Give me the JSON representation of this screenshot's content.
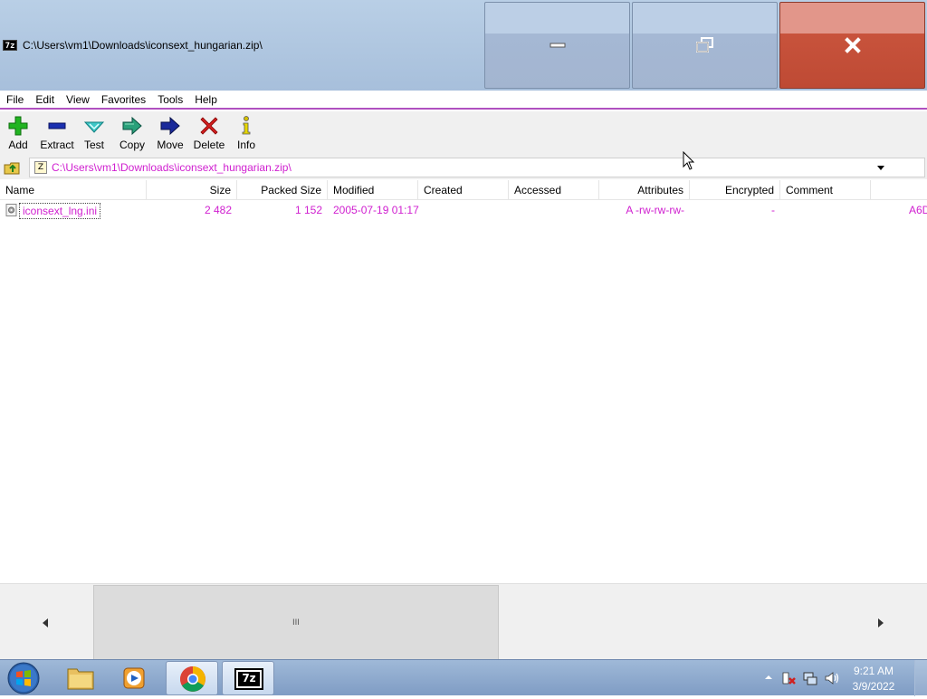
{
  "window": {
    "title": "C:\\Users\\vm1\\Downloads\\iconsext_hungarian.zip\\",
    "app_icon_text": "7z"
  },
  "menu": [
    "File",
    "Edit",
    "View",
    "Favorites",
    "Tools",
    "Help"
  ],
  "toolbar": {
    "add": "Add",
    "extract": "Extract",
    "test": "Test",
    "copy": "Copy",
    "move": "Move",
    "delete": "Delete",
    "info": "Info"
  },
  "address": {
    "path": "C:\\Users\\vm1\\Downloads\\iconsext_hungarian.zip\\"
  },
  "columns": {
    "name": "Name",
    "size": "Size",
    "packed_size": "Packed Size",
    "modified": "Modified",
    "created": "Created",
    "accessed": "Accessed",
    "attributes": "Attributes",
    "encrypted": "Encrypted",
    "comment": "Comment"
  },
  "files": [
    {
      "name": "iconsext_lng.ini",
      "size": "2 482",
      "packed_size": "1 152",
      "modified": "2005-07-19 01:17",
      "created": "",
      "accessed": "",
      "attributes": "A -rw-rw-rw-",
      "encrypted": "-",
      "comment": "",
      "crc_partial": "A6D"
    }
  ],
  "scrollbar": {
    "grip": "III"
  },
  "taskbar": {
    "time": "9:21 AM",
    "date": "3/9/2022",
    "seven_zip_label": "7z"
  },
  "colors": {
    "file_text": "#d020d0",
    "address_text": "#d020d0",
    "menu_underline": "#b050c0",
    "close_button": "#c8533c"
  }
}
